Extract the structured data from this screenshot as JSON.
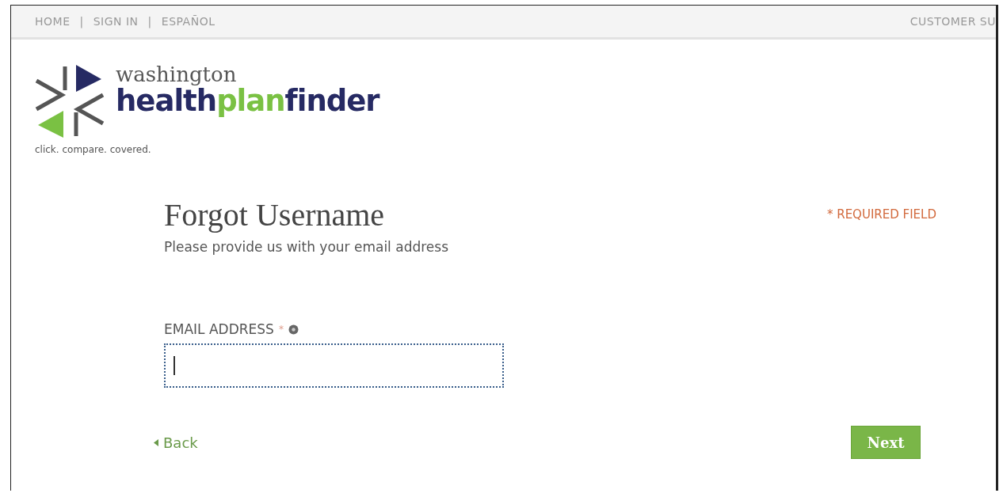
{
  "top_nav": {
    "links": [
      "HOME",
      "SIGN IN",
      "ESPAÑOL"
    ],
    "separator": "|",
    "right_link": "CUSTOMER SU"
  },
  "logo": {
    "state_name": "washington",
    "brand_parts": [
      "health",
      "plan",
      "finder"
    ],
    "tagline": "click. compare. covered."
  },
  "form": {
    "title": "Forgot Username",
    "subtitle": "Please provide us with your email address",
    "required_note": "* REQUIRED FIELD",
    "field": {
      "label": "EMAIL ADDRESS",
      "required_mark": "*",
      "focused": true
    },
    "back_link": "Back",
    "next_button": "Next"
  }
}
